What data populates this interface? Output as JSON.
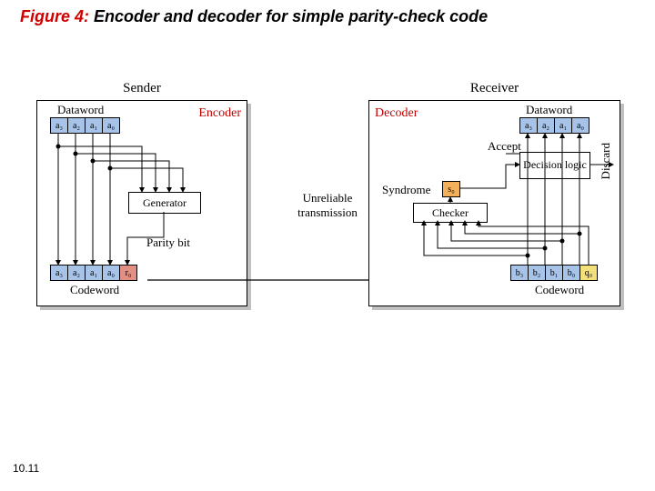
{
  "title": {
    "figure": "Figure 4:",
    "text": "Encoder and decoder for simple parity-check code"
  },
  "footer": "10.11",
  "sender": {
    "heading": "Sender",
    "encoder_label": "Encoder",
    "dataword_label": "Dataword",
    "dataword_cells": [
      "a₃",
      "a₂",
      "a₁",
      "a₀"
    ],
    "generator_label": "Generator",
    "paritybit_label": "Parity bit",
    "codeword_label": "Codeword",
    "codeword_cells": [
      "a₃",
      "a₂",
      "a₁",
      "a₀",
      "r₀"
    ]
  },
  "mid": {
    "unreliable": "Unreliable transmission"
  },
  "receiver": {
    "heading": "Receiver",
    "decoder_label": "Decoder",
    "dataword_label": "Dataword",
    "dataword_cells": [
      "a₃",
      "a₂",
      "a₁",
      "a₀"
    ],
    "accept_label": "Accept",
    "decision_label": "Decision logic",
    "discard_label": "Discard",
    "syndrome_label": "Syndrome",
    "syndrome_cell": "s₀",
    "checker_label": "Checker",
    "codeword_label": "Codeword",
    "codeword_cells": [
      "b₃",
      "b₂",
      "b₁",
      "b₀",
      "q₀"
    ]
  }
}
